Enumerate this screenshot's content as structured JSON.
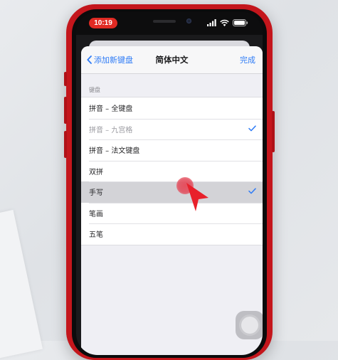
{
  "status_bar": {
    "time": "10:19",
    "icons": [
      "signal-icon",
      "wifi-icon",
      "battery-icon"
    ]
  },
  "navbar": {
    "back_label": "添加新键盘",
    "title": "简体中文",
    "done_label": "完成"
  },
  "section": {
    "header": "键盘"
  },
  "keyboards": [
    {
      "label": "拼音 – 全键盘",
      "checked": false,
      "state": "normal"
    },
    {
      "label": "拼音 – 九宫格",
      "checked": true,
      "state": "dim"
    },
    {
      "label": "拼音 – 法文键盘",
      "checked": false,
      "state": "normal"
    },
    {
      "label": "双拼",
      "checked": false,
      "state": "normal"
    },
    {
      "label": "手写",
      "checked": true,
      "state": "pressed"
    },
    {
      "label": "笔画",
      "checked": false,
      "state": "normal"
    },
    {
      "label": "五笔",
      "checked": false,
      "state": "normal"
    }
  ],
  "colors": {
    "accent": "#2f7cf6",
    "phone_body": "#c4161c",
    "time_pill": "#e02a23",
    "touch_indicator": "#e74858"
  }
}
